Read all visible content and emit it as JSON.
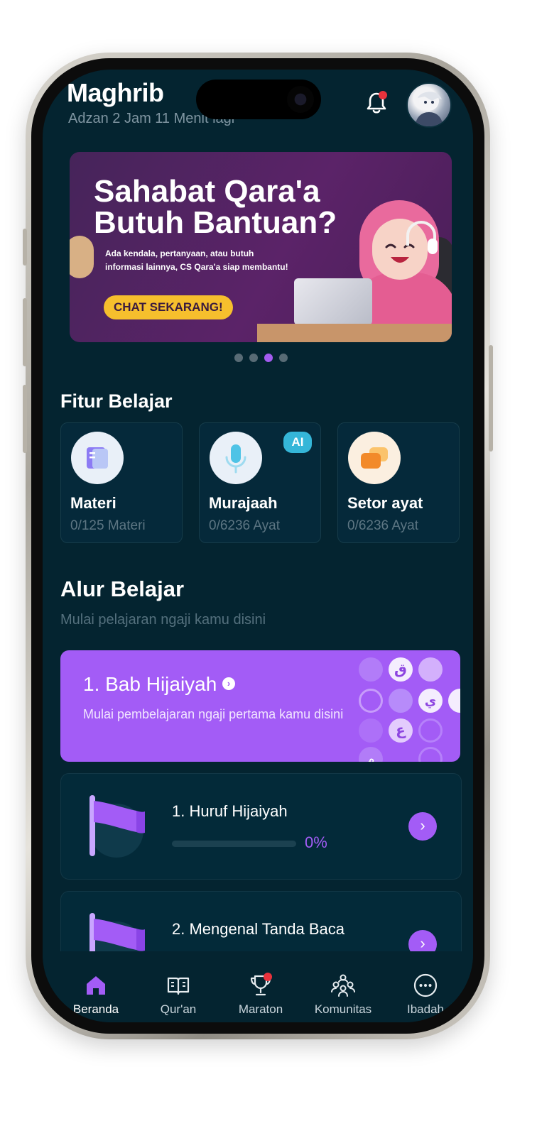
{
  "header": {
    "prayer_name": "Maghrib",
    "countdown": "Adzan 2 Jam 11 Menit lagi",
    "bell_icon": "bell-icon",
    "has_notification": true
  },
  "banner": {
    "title": "Sahabat Qara'a Butuh Bantuan?",
    "description": "Ada kendala, pertanyaan, atau butuh informasi lainnya, CS Qara'a siap membantu!",
    "cta": "CHAT SEKARANG!",
    "dots_total": 4,
    "dots_active_index": 2
  },
  "fitur": {
    "title": "Fitur Belajar",
    "cards": [
      {
        "name": "Materi",
        "progress": "0/125 Materi",
        "icon": "book-icon"
      },
      {
        "name": "Murajaah",
        "progress": "0/6236 Ayat",
        "icon": "microphone-icon",
        "badge": "AI"
      },
      {
        "name": "Setor ayat",
        "progress": "0/6236 Ayat",
        "icon": "chat-bubbles-icon"
      }
    ]
  },
  "alur": {
    "title": "Alur Belajar",
    "subtitle": "Mulai pelajaran ngaji kamu disini",
    "bab": {
      "title": "1. Bab Hijaiyah",
      "subtitle": "Mulai pembelajaran ngaji pertama kamu disini",
      "letters": [
        "ق",
        "ي",
        "ع",
        "م"
      ]
    },
    "lessons": [
      {
        "title": "1. Huruf Hijaiyah",
        "progress_label": "0%",
        "progress": 0
      },
      {
        "title": "2. Mengenal Tanda Baca"
      }
    ]
  },
  "nav": {
    "items": [
      {
        "label": "Beranda",
        "icon": "home-icon",
        "active": true
      },
      {
        "label": "Qur'an",
        "icon": "quran-book-icon"
      },
      {
        "label": "Maraton",
        "icon": "trophy-icon",
        "has_notification": true
      },
      {
        "label": "Komunitas",
        "icon": "community-icon"
      },
      {
        "label": "Ibadah",
        "icon": "more-icon"
      }
    ]
  },
  "colors": {
    "background": "#042430",
    "accent": "#a35cf6",
    "banner": "#5b2368",
    "cta": "#f6bf2d",
    "notification": "#e8323c"
  }
}
